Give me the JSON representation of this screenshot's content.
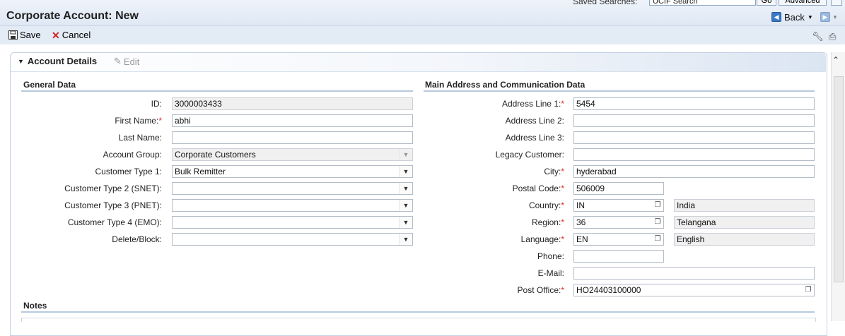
{
  "window": {
    "title": "Corporate Account: New",
    "saved_searches_label": "Saved Searches:",
    "saved_searches_value": "UCIF Search",
    "go_label": "Go",
    "advanced_label": "Advanced",
    "back_label": "Back"
  },
  "toolbar": {
    "save_label": "Save",
    "cancel_label": "Cancel"
  },
  "panel": {
    "title": "Account Details",
    "edit_label": "Edit"
  },
  "general": {
    "title": "General Data",
    "rows": [
      {
        "label": "ID:",
        "value": "3000003433",
        "required": false
      },
      {
        "label": "First Name:",
        "value": "abhi",
        "required": true
      },
      {
        "label": "Last Name:",
        "value": "",
        "required": false
      },
      {
        "label": "Account Group:",
        "value": "Corporate Customers",
        "required": false
      },
      {
        "label": "Customer Type 1:",
        "value": "Bulk Remitter",
        "required": false
      },
      {
        "label": "Customer Type 2 (SNET):",
        "value": "",
        "required": false
      },
      {
        "label": "Customer Type 3 (PNET):",
        "value": "",
        "required": false
      },
      {
        "label": "Customer Type 4 (EMO):",
        "value": "",
        "required": false
      },
      {
        "label": "Delete/Block:",
        "value": "",
        "required": false
      }
    ]
  },
  "address": {
    "title": "Main Address and Communication Data",
    "rows": [
      {
        "label": "Address Line 1:",
        "value": "5454",
        "required": true
      },
      {
        "label": "Address Line 2:",
        "value": "",
        "required": false
      },
      {
        "label": "Address Line 3:",
        "value": "",
        "required": false
      },
      {
        "label": "Legacy Customer:",
        "value": "",
        "required": false
      },
      {
        "label": "City:",
        "value": "hyderabad",
        "required": true
      },
      {
        "label": "Postal Code:",
        "value": "506009",
        "required": true
      },
      {
        "label": "Country:",
        "value": "IN",
        "desc": "India",
        "required": true
      },
      {
        "label": "Region:",
        "value": "36",
        "desc": "Telangana",
        "required": true
      },
      {
        "label": "Language:",
        "value": "EN",
        "desc": "English",
        "required": true
      },
      {
        "label": "Phone:",
        "value": "",
        "required": false
      },
      {
        "label": "E-Mail:",
        "value": "",
        "required": false
      },
      {
        "label": "Post Office:",
        "value": "HO24403100000",
        "required": true
      }
    ]
  },
  "notes": {
    "title": "Notes"
  },
  "colors": {
    "accent": "#3a78c6",
    "required": "#e0261f",
    "section_line": "#b8c9de"
  }
}
